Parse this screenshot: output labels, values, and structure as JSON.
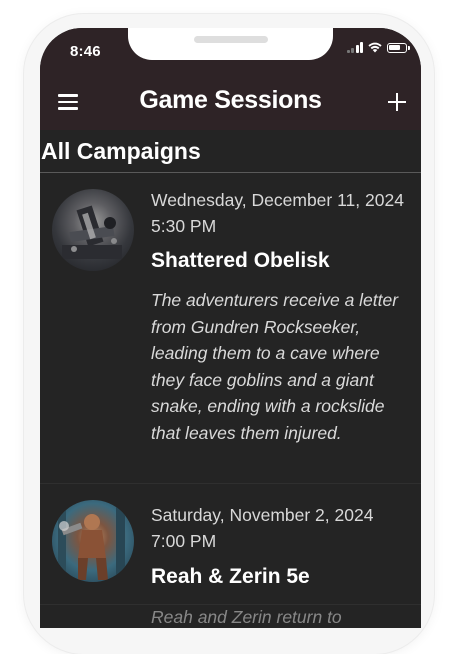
{
  "status_bar": {
    "time": "8:46"
  },
  "header": {
    "title": "Game Sessions"
  },
  "main": {
    "section_title": "All Campaigns",
    "sessions": [
      {
        "date": "Wednesday, December 11, 2024 5:30 PM",
        "name": "Shattered Obelisk",
        "description": "The adventurers receive a letter from Gundren Rockseeker, leading them to a cave where they face goblins and a giant snake, ending with a rockslide that leaves them injured."
      },
      {
        "date": "Saturday, November 2, 2024 7:00 PM",
        "name": "Reah & Zerin 5e",
        "description": "Reah and Zerin return to"
      }
    ]
  }
}
